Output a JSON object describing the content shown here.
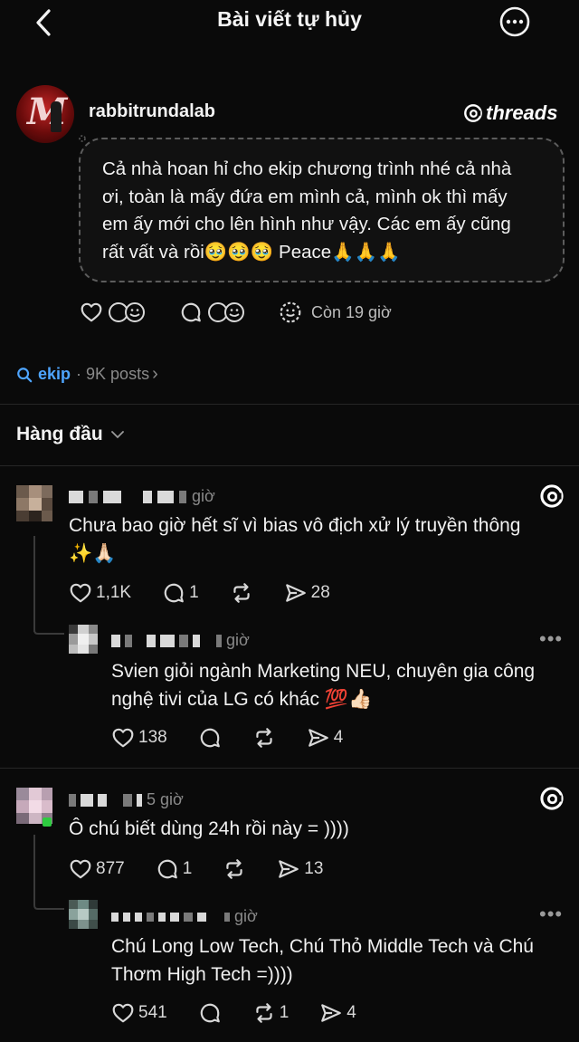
{
  "header": {
    "title": "Bài viết tự hủy",
    "back_icon": "chevron-left-icon",
    "more_icon": "more-circle-icon"
  },
  "post": {
    "username": "rabbitrundalab",
    "brand": "threads",
    "text_lines": [
      "Cả nhà hoan hỉ cho ekip chương trình nhé cả nhà",
      "ơi, toàn là mấy đứa em mình cả, mình ok thì mấy",
      "em ấy mới cho lên hình như vậy. Các em ấy cũng",
      "rất vất và rồi🥹🥹🥹 Peace🙏🙏🙏"
    ],
    "timer_label": "Còn 19 giờ"
  },
  "tag": {
    "name": "ekip",
    "meta": "· 9K posts",
    "chevron": "›"
  },
  "sort": {
    "label": "Hàng đầu"
  },
  "comments": [
    {
      "time": "giờ",
      "text_lines": [
        "Chưa bao giờ hết sĩ vì bias vô địch xử lý truyền thông",
        "✨🙏🏻"
      ],
      "likes": "1,1K",
      "replies": "1",
      "shares": "28",
      "reply": {
        "time": "giờ",
        "text_lines": [
          "Svien giỏi ngành Marketing NEU, chuyên gia công",
          "nghệ tivi của LG có khác 💯👍🏻"
        ],
        "likes": "138",
        "shares": "4"
      }
    },
    {
      "time": "5 giờ",
      "text_lines": [
        "Ô chú biết dùng 24h rồi này = ))))"
      ],
      "likes": "877",
      "replies": "1",
      "shares": "13",
      "reply": {
        "time": "giờ",
        "text_lines": [
          "Chú Long Low Tech, Chú Thỏ Middle Tech và Chú",
          "Thơm High Tech =))))"
        ],
        "likes": "541",
        "reposts": "1",
        "shares": "4"
      }
    }
  ],
  "more_dots": "•••"
}
